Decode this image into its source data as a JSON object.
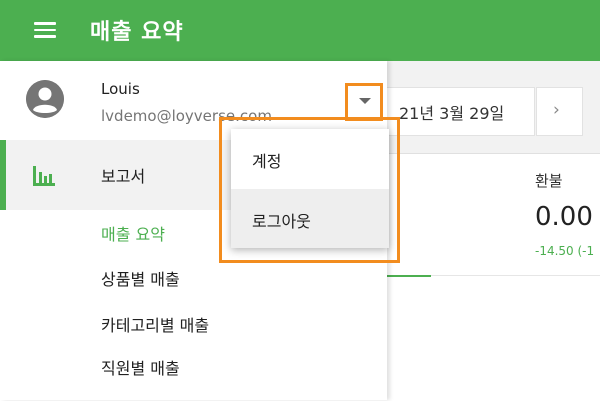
{
  "appbar": {
    "title": "매출 요약",
    "menu_icon": "hamburger-icon",
    "color": "#4CAF50"
  },
  "user": {
    "name": "Louis",
    "email": "lvdemo@loyverse.com",
    "avatar_icon": "account-circle-icon",
    "dropdown_icon": "arrow-drop-down-icon"
  },
  "drawer": {
    "section": {
      "label": "보고서",
      "icon": "bar-chart-icon"
    },
    "items": [
      {
        "label": "매출 요약",
        "active": true
      },
      {
        "label": "상품별 매출",
        "active": false
      },
      {
        "label": "카테고리별 매출",
        "active": false
      },
      {
        "label": "직원별 매출",
        "active": false
      }
    ]
  },
  "popup_menu": {
    "items": [
      "계정",
      "로그아웃"
    ],
    "hovered": "로그아웃"
  },
  "background": {
    "date_range": "21년 3월 29일",
    "next_icon": "chevron-right-icon",
    "refund_label": "환불",
    "refund_value": "0.00",
    "refund_delta": "-14.50 (-1"
  },
  "colors": {
    "accent": "#4CAF50",
    "highlight": "#F28C1E"
  }
}
